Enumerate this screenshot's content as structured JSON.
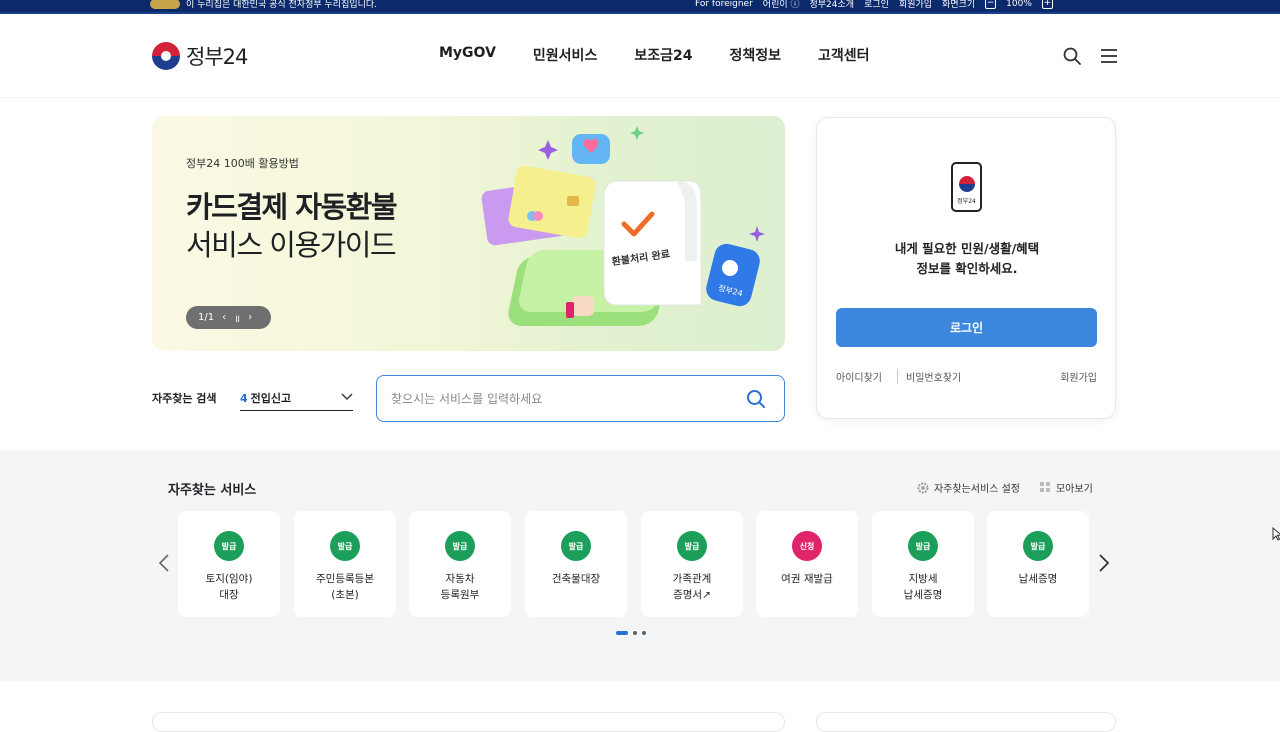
{
  "topbar": {
    "notice": "이 누리집은 대한민국 공식 전자정부 누리집입니다.",
    "foreigner": "For foreigner",
    "links": [
      "어린이 ⓘ",
      "정부24소개",
      "로그인",
      "회원가입",
      "화면크기"
    ],
    "zoom_minus": "−",
    "zoom_value": "100%",
    "zoom_plus": "+"
  },
  "header": {
    "logo_text": "정부24",
    "nav": [
      "MyGOV",
      "민원서비스",
      "보조금24",
      "정책정보",
      "고객센터"
    ],
    "icons": [
      "search-icon",
      "menu-icon"
    ]
  },
  "banner": {
    "eyebrow": "정부24 100배 활용방법",
    "title_line1": "카드결제 자동환불",
    "title_line2": "서비스 이용가이드",
    "pager": "1/1",
    "receipt_text": "환불처리 완료",
    "badge_text": "정부24"
  },
  "login": {
    "phone_label": "정부24",
    "message_line1": "내게 필요한 민원/생활/혜택",
    "message_line2": "정보를 확인하세요.",
    "button": "로그인",
    "find_id": "아이디찾기",
    "find_pw": "비밀번호찾기",
    "signup": "회원가입"
  },
  "search": {
    "label": "자주찾는 검색",
    "keyword_num": "4",
    "keyword": "전입신고",
    "placeholder": "찾으시는 서비스를 입력하세요"
  },
  "services": {
    "title": "자주찾는 서비스",
    "settings": "자주찾는서비스 설정",
    "view_all": "모아보기",
    "items": [
      {
        "badge": "발급",
        "line1": "토지(임야)",
        "line2": "대장",
        "color": "#1b9f5a"
      },
      {
        "badge": "발급",
        "line1": "주민등록등본",
        "line2": "(초본)",
        "color": "#1b9f5a"
      },
      {
        "badge": "발급",
        "line1": "자동차",
        "line2": "등록원부",
        "color": "#1b9f5a"
      },
      {
        "badge": "발급",
        "line1": "건축물대장",
        "line2": "",
        "color": "#1b9f5a"
      },
      {
        "badge": "발급",
        "line1": "가족관계",
        "line2": "증명서↗",
        "color": "#1b9f5a"
      },
      {
        "badge": "신청",
        "line1": "여권 재발급",
        "line2": "",
        "color": "#e0246a"
      },
      {
        "badge": "발급",
        "line1": "지방세",
        "line2": "납세증명",
        "color": "#1b9f5a"
      },
      {
        "badge": "발급",
        "line1": "납세증명",
        "line2": "",
        "color": "#1b9f5a"
      }
    ],
    "page_count": 3,
    "active_page": 1
  }
}
